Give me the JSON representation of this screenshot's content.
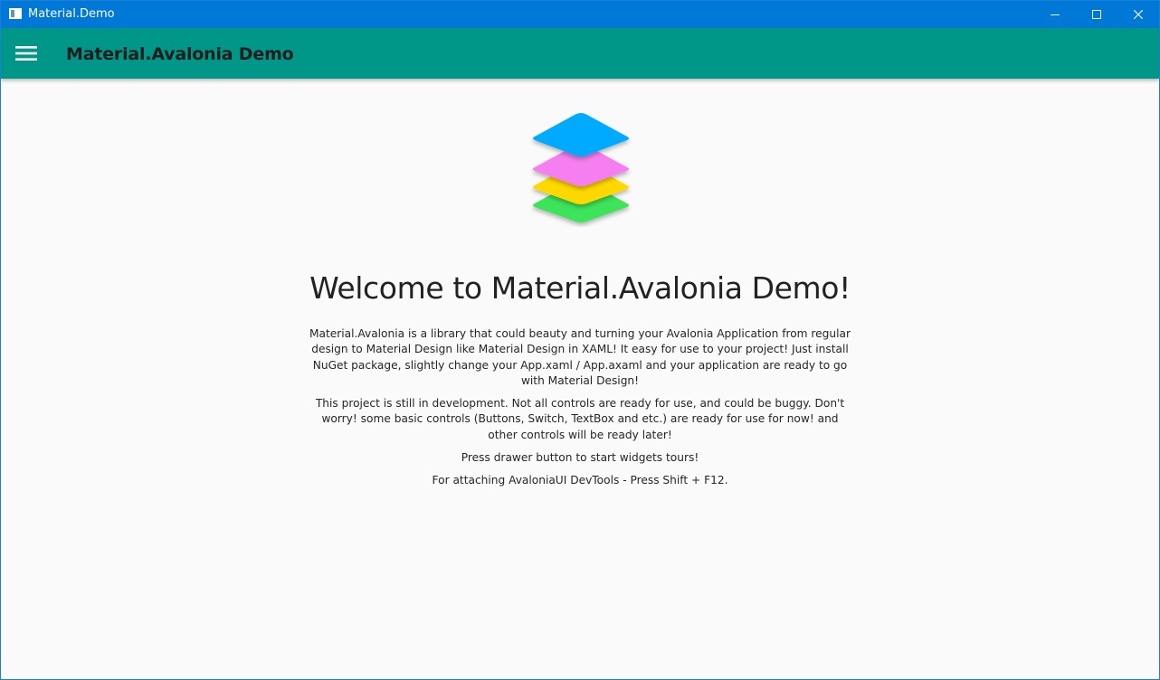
{
  "window": {
    "title": "Material.Demo",
    "controls": {
      "minimize_icon": "minimize-icon",
      "maximize_icon": "maximize-icon",
      "close_icon": "close-icon"
    },
    "accent": "#0078d7"
  },
  "appbar": {
    "title": "Material.Avalonia Demo",
    "menu_icon": "hamburger-menu-icon",
    "color": "#009688"
  },
  "main": {
    "logo_icon": "stacked-layers-logo",
    "logo_colors": [
      "#00aaff",
      "#f57ff0",
      "#ffd800",
      "#3ee45a"
    ],
    "heading": "Welcome to Material.Avalonia Demo!",
    "paragraphs": [
      "Material.Avalonia is a library that could beauty and turning your Avalonia Application from regular design to Material Design like Material Design in XAML! It easy for use to your project! Just install NuGet package, slightly change your App.xaml / App.axaml and your application are ready to go with Material Design!",
      "This project is still in development. Not all controls are ready for use, and could be buggy. Don't worry! some basic controls (Buttons, Switch, TextBox and etc.) are ready for use for now! and other controls will be ready later!",
      "Press drawer button to start widgets tours!",
      "For attaching AvaloniaUI DevTools - Press Shift + F12."
    ]
  }
}
